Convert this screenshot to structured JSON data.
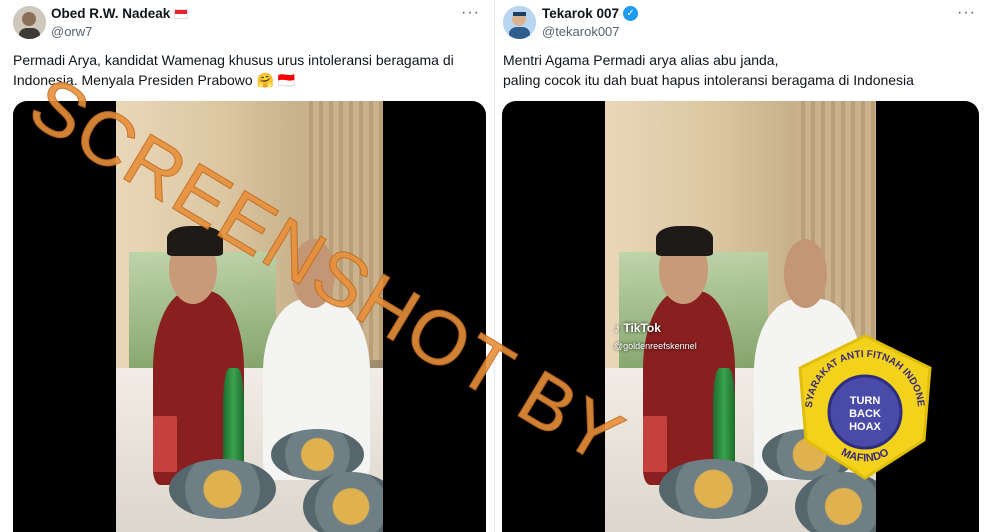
{
  "left_post": {
    "display_name": "Obed R.W. Nadeak",
    "handle": "@orw7",
    "more_label": "···",
    "text_line1": "Permadi Arya, kandidat Wamenag khusus urus intoleransi beragama di",
    "text_line2": "Indonesia. Menyala Presiden Prabowo 🤗 🇮🇩"
  },
  "right_post": {
    "display_name": "Tekarok 007",
    "handle": "@tekarok007",
    "more_label": "···",
    "text_line1": "Mentri Agama Permadi arya alias abu janda,",
    "text_line2": "paling cocok itu dah buat hapus intoleransi beragama di Indonesia"
  },
  "video_overlay": {
    "app_name": "TikTok",
    "username": "@goldenreefskennel"
  },
  "watermark": {
    "text": "SCREENSHOT BY"
  },
  "badge": {
    "top_text": "MASYARAKAT ANTI FITNAH INDONESIA",
    "bottom_text": "MAFINDO",
    "center_line1": "TURN",
    "center_line2": "BACK",
    "center_line3": "HOAX"
  },
  "colors": {
    "watermark": "#e8903a",
    "badge_yellow": "#f2d21a",
    "verified_blue": "#1d9bf0",
    "flag_red": "#e3242b"
  }
}
